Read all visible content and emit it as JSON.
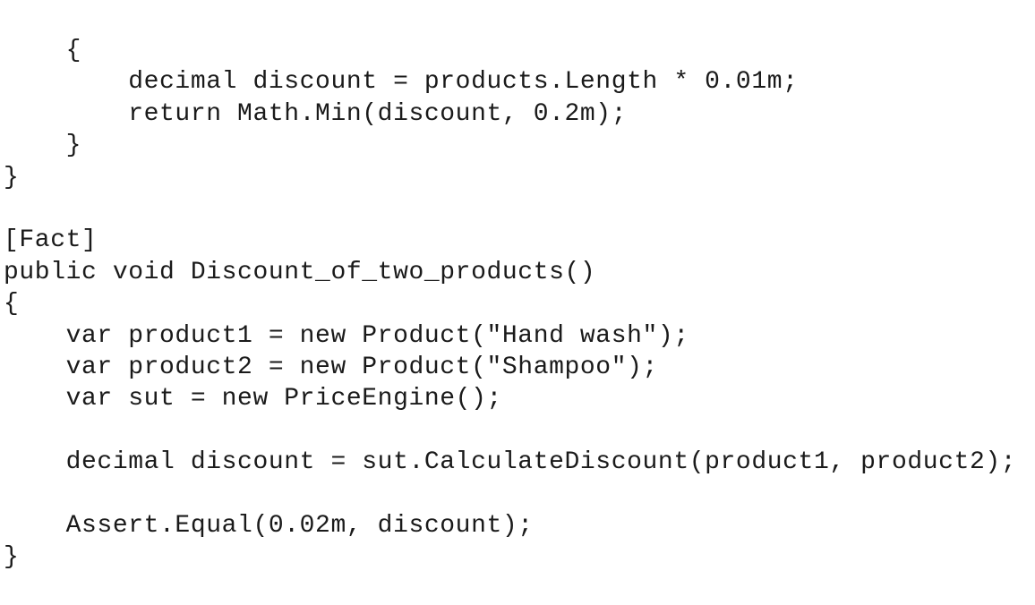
{
  "code": {
    "lines": [
      "    {",
      "        decimal discount = products.Length * 0.01m;",
      "        return Math.Min(discount, 0.2m);",
      "    }",
      "}",
      "",
      "[Fact]",
      "public void Discount_of_two_products()",
      "{",
      "    var product1 = new Product(\"Hand wash\");",
      "    var product2 = new Product(\"Shampoo\");",
      "    var sut = new PriceEngine();",
      "",
      "    decimal discount = sut.CalculateDiscount(product1, product2);",
      "",
      "    Assert.Equal(0.02m, discount);",
      "}"
    ]
  }
}
